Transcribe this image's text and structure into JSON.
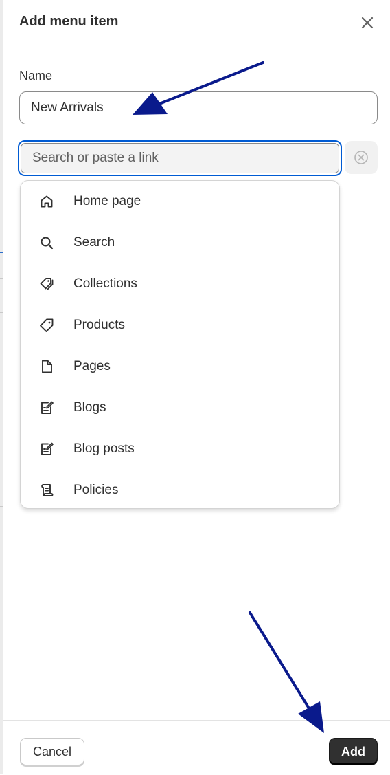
{
  "dialog": {
    "title": "Add menu item",
    "close_icon": "close-icon"
  },
  "name_field": {
    "label": "Name",
    "value": "New Arrivals"
  },
  "link_field": {
    "placeholder": "Search or paste a link",
    "value": "",
    "clear_icon": "circle-x-icon",
    "focus_color": "#005bd3"
  },
  "link_options": [
    {
      "label": "Home page",
      "icon": "home-icon"
    },
    {
      "label": "Search",
      "icon": "search-icon"
    },
    {
      "label": "Collections",
      "icon": "collections-tag-icon"
    },
    {
      "label": "Products",
      "icon": "product-tag-icon"
    },
    {
      "label": "Pages",
      "icon": "page-icon"
    },
    {
      "label": "Blogs",
      "icon": "blog-icon"
    },
    {
      "label": "Blog posts",
      "icon": "blog-post-icon"
    },
    {
      "label": "Policies",
      "icon": "policy-scroll-icon"
    }
  ],
  "footer": {
    "cancel_label": "Cancel",
    "add_label": "Add"
  },
  "annotation_color": "#0a1a8c"
}
